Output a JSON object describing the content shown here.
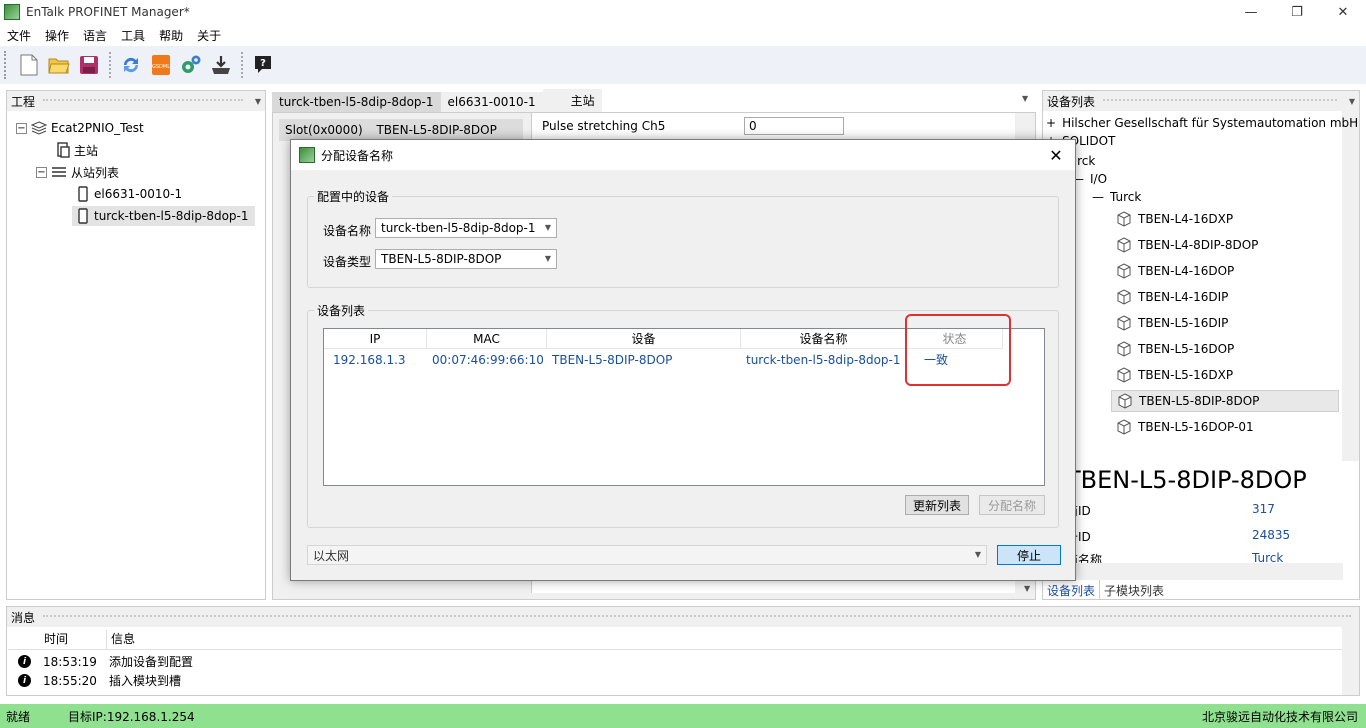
{
  "window": {
    "title": "EnTalk PROFINET Manager*"
  },
  "menu": [
    "文件",
    "操作",
    "语言",
    "工具",
    "帮助",
    "关于"
  ],
  "project_panel": {
    "title": "工程",
    "tree": {
      "root": "Ecat2PNIO_Test",
      "master": "主站",
      "slave_list": "从站列表",
      "slaves": [
        "el6631-0010-1",
        "turck-tben-l5-8dip-8dop-1"
      ]
    }
  },
  "tabs": [
    "turck-tben-l5-8dip-8dop-1",
    "el6631-0010-1",
    "主站"
  ],
  "slot": {
    "id": "Slot(0x0000)",
    "device": "TBEN-L5-8DIP-8DOP"
  },
  "param": {
    "name": "Pulse stretching Ch5",
    "value": "0"
  },
  "device_list_panel": {
    "title": "设备列表",
    "vendors": [
      "Hilscher Gesellschaft für Systemautomation mbH",
      "SOLIDOT",
      "Turck"
    ],
    "category": "I/O",
    "sub": "Turck",
    "devices": [
      "TBEN-L4-16DXP",
      "TBEN-L4-8DIP-8DOP",
      "TBEN-L4-16DOP",
      "TBEN-L4-16DIP",
      "TBEN-L5-16DIP",
      "TBEN-L5-16DOP",
      "TBEN-L5-16DXP",
      "TBEN-L5-8DIP-8DOP",
      "TBEN-L5-16DOP-01"
    ],
    "selected_index": 7,
    "detail": {
      "title": "TBEN-L5-8DIP-8DOP",
      "rows": [
        {
          "label": "商ID",
          "value": "317"
        },
        {
          "label": "备ID",
          "value": "24835"
        },
        {
          "label": "商名称",
          "value": "Turck"
        }
      ]
    },
    "bottom_tabs": [
      "设备列表",
      "子模块列表"
    ]
  },
  "messages": {
    "title": "消息",
    "columns": [
      "时间",
      "信息"
    ],
    "rows": [
      {
        "time": "18:53:19",
        "info": "添加设备到配置"
      },
      {
        "time": "18:55:20",
        "info": "插入模块到槽"
      }
    ]
  },
  "statusbar": {
    "left": "就绪",
    "target": "目标IP:192.168.1.254",
    "company": "北京骏远自动化技术有限公司"
  },
  "dialog": {
    "title": "分配设备名称",
    "group_config": "配置中的设备",
    "device_name_label": "设备名称",
    "device_name_value": "turck-tben-l5-8dip-8dop-1",
    "device_type_label": "设备类型",
    "device_type_value": "TBEN-L5-8DIP-8DOP",
    "group_list": "设备列表",
    "columns": [
      "IP",
      "MAC",
      "设备",
      "设备名称",
      "状态"
    ],
    "rows": [
      {
        "ip": "192.168.1.3",
        "mac": "00:07:46:99:66:10",
        "device": "TBEN-L5-8DIP-8DOP",
        "name": "turck-tben-l5-8dip-8dop-1",
        "status": "一致"
      }
    ],
    "refresh_btn": "更新列表",
    "assign_btn": "分配名称",
    "adapter": "以太网",
    "stop_btn": "停止"
  },
  "colors": {
    "statusbar": "#8fe08f",
    "highlight": "#e03030",
    "link": "#1a4fa0"
  }
}
